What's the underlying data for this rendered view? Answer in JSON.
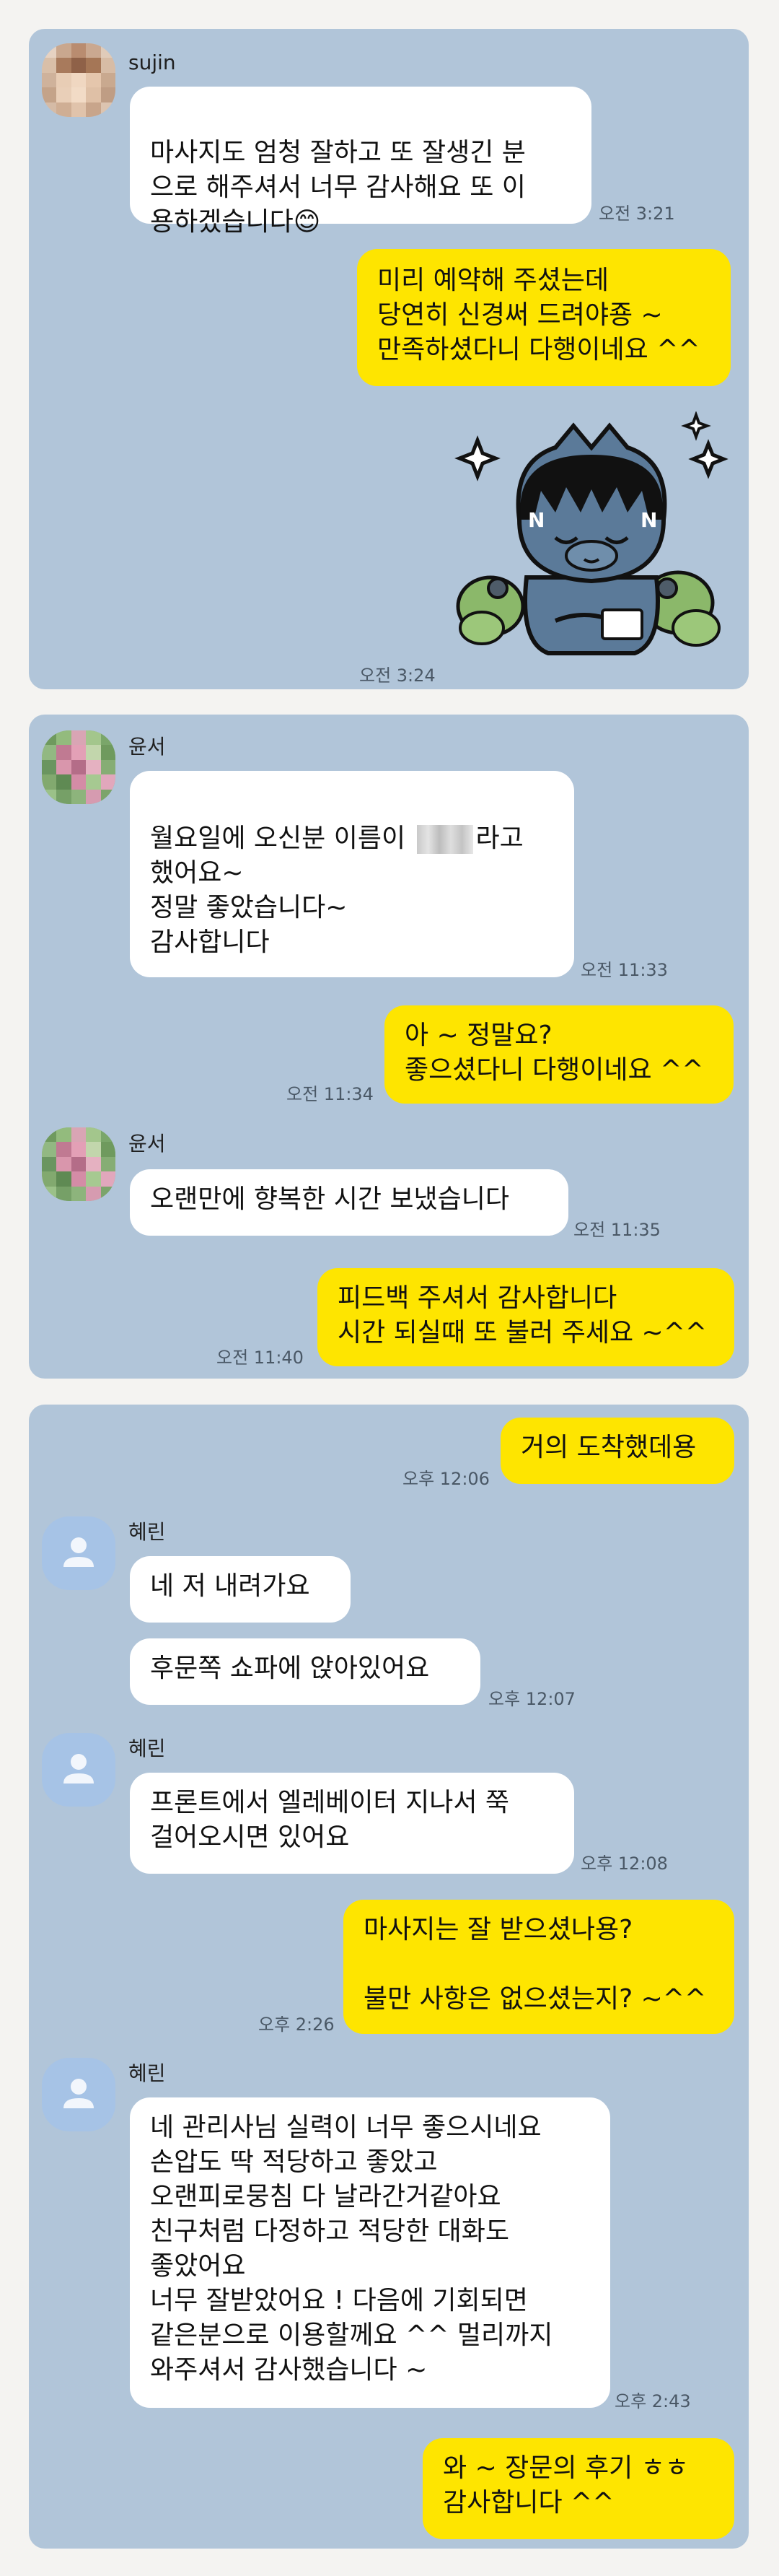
{
  "panel1": {
    "sender": "sujin",
    "msg1": "마사지도 엄청 잘하고 또 잘생긴 분\n으로 해주셔서 너무 감사해요 또 이\n용하겠습니다",
    "msg1_emoji": "😊",
    "time1": "오전 3:21",
    "reply1": "미리 예약해 주셨는데\n당연히 신경써 드려야죵 ~\n만족하셨다니 다행이네요 ^^",
    "sticker_time": "오전 3:24"
  },
  "panel2": {
    "sender": "윤서",
    "msg1_pre": "월요일에 오신분 이름이 ",
    "msg1_post": "라고\n했어요~\n정말 좋았습니다~\n감사합니다",
    "time1": "오전 11:33",
    "reply1": "아 ~ 정말요?\n좋으셨다니 다행이네요 ^^",
    "reply1_time": "오전 11:34",
    "sender2": "윤서",
    "msg2": "오랜만에 향복한 시간 보냈습니다",
    "time2": "오전 11:35",
    "reply2": "피드백 주셔서 감사합니다\n시간 되실때 또 불러 주세요 ~^^",
    "reply2_time": "오전 11:40"
  },
  "panel3": {
    "out1": "거의 도착했데용",
    "out1_time": "오후 12:06",
    "sender": "혜린",
    "in1": "네 저 내려가요",
    "in2": "후문쪽 쇼파에 앉아있어요",
    "in2_time": "오후 12:07",
    "sender2": "혜린",
    "in3": "프론트에서 엘레베이터 지나서 쭉\n걸어오시면 있어요",
    "in3_time": "오후 12:08",
    "out2": "마사지는 잘 받으셨나용?\n\n불만 사항은 없으셨는지? ~^^",
    "out2_time": "오후 2:26",
    "sender3": "혜린",
    "in4": "네 관리사님 실력이 너무 좋으시네요\n손압도 딱 적당하고 좋았고\n오랜피로뭉침 다 날라간거같아요\n친구처럼 다정하고 적당한 대화도\n좋았어요\n너무 잘받았어요 ! 다음에 기회되면\n같은분으로 이용할께요 ^^ 멀리까지\n와주셔서 감사했습니다 ~",
    "in4_time": "오후 2:43",
    "out3": "와 ~ 장문의 후기 ㅎㅎ\n감사합니다 ^^"
  },
  "colors": {
    "chat_bg": "#b1c5d9",
    "outgoing_bubble": "#fee500",
    "incoming_bubble": "#ffffff",
    "default_avatar": "#a6c3e6"
  },
  "icons": {
    "default_avatar": "person-silhouette-icon",
    "sticker": "kakao-friends-character-sticker"
  }
}
